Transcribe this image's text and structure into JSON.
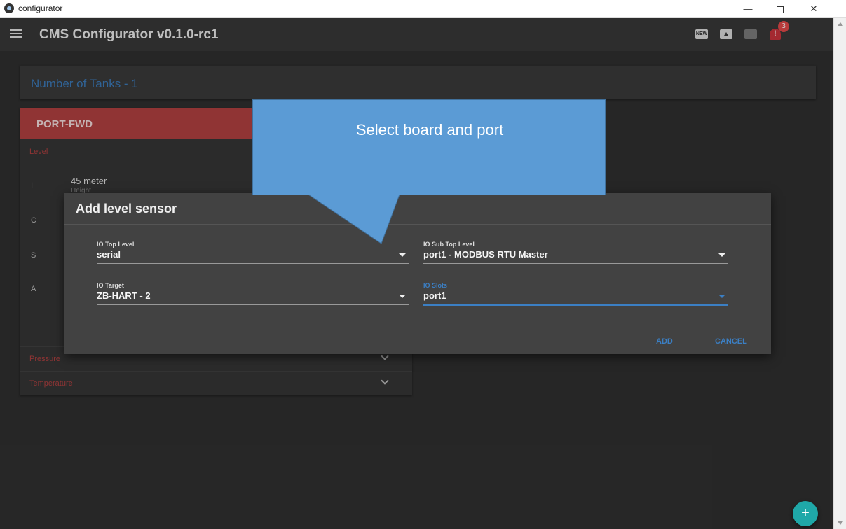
{
  "window": {
    "title": "configurator",
    "minimize": "—",
    "close": "✕"
  },
  "toolbar": {
    "title": "CMS Configurator v0.1.0-rc1",
    "new_label": "NEW",
    "notification_count": "3"
  },
  "tanks": {
    "count_label": "Number of Tanks - 1"
  },
  "tank": {
    "name": "PORT-FWD",
    "level_section": "Level",
    "row_letters": [
      "I",
      "C",
      "S",
      "A"
    ],
    "height_value": "45 meter",
    "height_label": "Height",
    "sections": [
      "Pressure",
      "Temperature"
    ]
  },
  "dialog": {
    "title": "Add level sensor",
    "fields": [
      {
        "label": "IO Top Level",
        "value": "serial"
      },
      {
        "label": "IO Sub Top Level",
        "value": "port1 - MODBUS RTU Master"
      },
      {
        "label": "IO Target",
        "value": "ZB-HART - 2"
      },
      {
        "label": "IO Slots",
        "value": "port1"
      }
    ],
    "add_label": "ADD",
    "cancel_label": "CANCEL"
  },
  "callout": {
    "text": "Select board and port"
  },
  "fab": {
    "label": "+"
  },
  "colors": {
    "accent": "#3b7fc4",
    "tank_header": "#b04040",
    "callout": "#5b9bd5",
    "fab": "#1fa8a8"
  }
}
